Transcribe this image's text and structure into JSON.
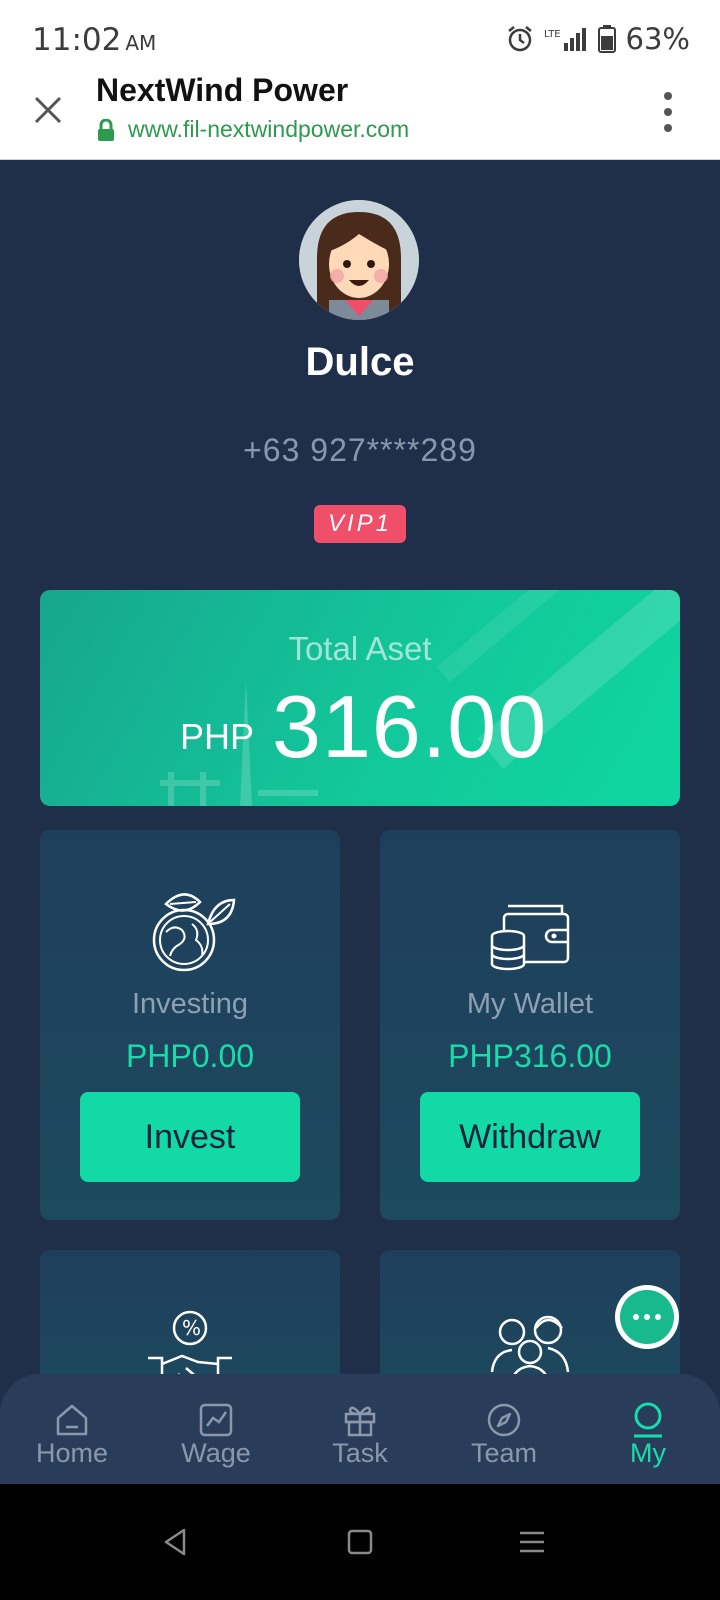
{
  "status_bar": {
    "time": "11:02",
    "ampm": "AM",
    "network": "LTE",
    "battery": "63%"
  },
  "browser": {
    "title": "NextWind Power",
    "url": "www.fil-nextwindpower.com"
  },
  "profile": {
    "name": "Dulce",
    "phone": "+63 927****289",
    "vip": "VIP1"
  },
  "asset_card": {
    "label": "Total Aset",
    "currency": "PHP",
    "amount": "316.00"
  },
  "tiles": {
    "investing": {
      "label": "Investing",
      "value": "PHP0.00",
      "button": "Invest",
      "icon": "globe-leaf-icon"
    },
    "wallet": {
      "label": "My Wallet",
      "value": "PHP316.00",
      "button": "Withdraw",
      "icon": "wallet-coins-icon"
    },
    "commission": {
      "icon": "handshake-percent-icon"
    },
    "team": {
      "icon": "family-group-icon"
    }
  },
  "tab_bar": {
    "items": [
      {
        "label": "Home",
        "icon": "home-icon"
      },
      {
        "label": "Wage",
        "icon": "chart-icon"
      },
      {
        "label": "Task",
        "icon": "gift-icon"
      },
      {
        "label": "Team",
        "icon": "compass-icon"
      },
      {
        "label": "My",
        "icon": "user-icon"
      }
    ],
    "active": "My"
  },
  "colors": {
    "background": "#1f2f4a",
    "accent": "#19dcaa",
    "vip": "#ef4f69",
    "tile": "#1e3f5c",
    "url_green": "#2e9a4e"
  }
}
